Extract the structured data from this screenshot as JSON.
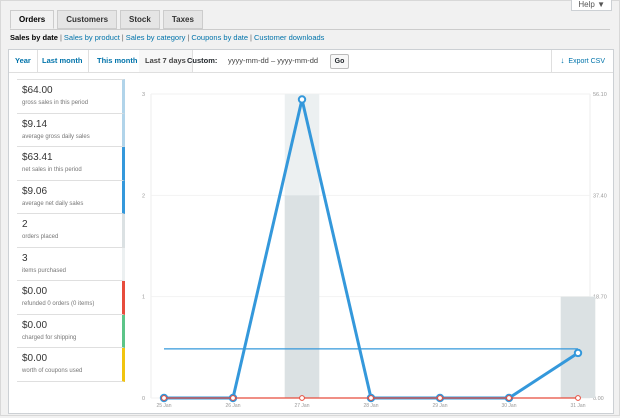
{
  "help": {
    "label": "Help ▼"
  },
  "tabs": [
    {
      "label": "Orders",
      "active": true
    },
    {
      "label": "Customers",
      "active": false
    },
    {
      "label": "Stock",
      "active": false
    },
    {
      "label": "Taxes",
      "active": false
    }
  ],
  "sublinks": {
    "current": "Sales by date",
    "items": [
      "Sales by product",
      "Sales by category",
      "Coupons by date",
      "Customer downloads"
    ]
  },
  "ranges": [
    {
      "label": "Year"
    },
    {
      "label": "Last month"
    },
    {
      "label": "This month"
    },
    {
      "label": "Last 7 days",
      "active": true
    }
  ],
  "custom": {
    "label": "Custom:",
    "from": "yyyy-mm-dd",
    "sep": "–",
    "to": "yyyy-mm-dd",
    "go": "Go"
  },
  "export": {
    "label": "Export CSV"
  },
  "legend": [
    {
      "value": "$64.00",
      "label": "gross sales in this period",
      "color": "#b1d4ea"
    },
    {
      "value": "$9.14",
      "label": "average gross daily sales",
      "color": "#b1d4ea"
    },
    {
      "value": "$63.41",
      "label": "net sales in this period",
      "color": "#3498db"
    },
    {
      "value": "$9.06",
      "label": "average net daily sales",
      "color": "#3498db"
    },
    {
      "value": "2",
      "label": "orders placed",
      "color": "#dbe1e3"
    },
    {
      "value": "3",
      "label": "items purchased",
      "color": "#ecf0f1"
    },
    {
      "value": "$0.00",
      "label": "refunded 0 orders (0 items)",
      "color": "#e74c3c"
    },
    {
      "value": "$0.00",
      "label": "charged for shipping",
      "color": "#5cc488"
    },
    {
      "value": "$0.00",
      "label": "worth of coupons used",
      "color": "#f1c40f"
    }
  ],
  "chart_data": {
    "type": "line",
    "categories": [
      "25 Jan",
      "26 Jan",
      "27 Jan",
      "28 Jan",
      "29 Jan",
      "30 Jan",
      "31 Jan"
    ],
    "y_left_ticks": [
      "0",
      "1",
      "2",
      "3"
    ],
    "y_right_ticks": [
      "0.00",
      "18.70",
      "37.40",
      "56.10"
    ],
    "ylim_left": [
      0,
      3
    ],
    "ylim_right": [
      0,
      56.1
    ],
    "series": [
      {
        "values": [
          0,
          0,
          2,
          0,
          0,
          0,
          1
        ],
        "axis": "left",
        "kind": "bar",
        "color": "#dbe1e3"
      },
      {
        "values": [
          0,
          0,
          3,
          0,
          0,
          0,
          1
        ],
        "axis": "left",
        "kind": "bar",
        "color": "#ecf0f1"
      },
      {
        "values": [
          0,
          0,
          55.1,
          0,
          0,
          0,
          8.31
        ],
        "axis": "right",
        "kind": "line",
        "color": "#3498db"
      },
      {
        "values": [
          9.06,
          9.06,
          9.06,
          9.06,
          9.06,
          9.06,
          9.06
        ],
        "axis": "right",
        "kind": "line",
        "color": "#3498db"
      },
      {
        "values": [
          0,
          0,
          0,
          0,
          0,
          0,
          0
        ],
        "axis": "right",
        "kind": "line",
        "color": "#e74c3c"
      }
    ]
  }
}
